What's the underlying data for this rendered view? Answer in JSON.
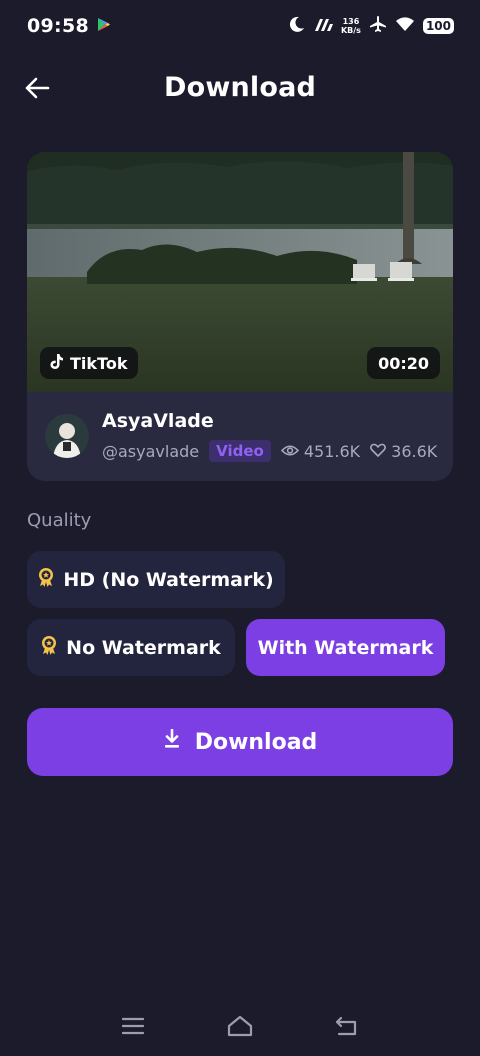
{
  "status_bar": {
    "time": "09:58",
    "speed_value": "136",
    "speed_unit": "KB/s",
    "battery": "100",
    "icons": [
      "play-store-icon",
      "moon-icon",
      "signal-icon",
      "airplane-icon",
      "wifi-icon"
    ]
  },
  "header": {
    "title": "Download",
    "back_icon": "arrow-left-icon"
  },
  "video": {
    "platform": "TikTok",
    "duration": "00:20",
    "author_name": "AsyaVlade",
    "author_handle": "@asyavlade",
    "type_badge": "Video",
    "views": "451.6K",
    "likes": "36.6K"
  },
  "quality": {
    "label": "Quality",
    "options": [
      {
        "label": "HD (No Watermark)",
        "icon": "award-icon",
        "selected": false
      },
      {
        "label": "No Watermark",
        "icon": "award-icon",
        "selected": false
      },
      {
        "label": "With Watermark",
        "selected": true
      }
    ]
  },
  "download_button": {
    "label": "Download",
    "icon": "download-icon"
  },
  "colors": {
    "background": "#1c1b2b",
    "card": "#29293f",
    "accent": "#7b3fe4",
    "option_bg": "#22253d",
    "award_gold": "#f3c24a"
  }
}
